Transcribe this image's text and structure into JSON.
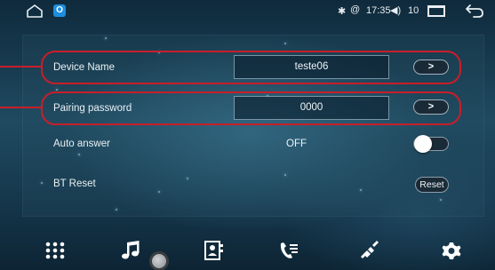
{
  "status_bar": {
    "app_badge": "O",
    "bluetooth_icon": "bluetooth-icon",
    "wifi_icon": "wifi-icon",
    "time": "17:35",
    "volume_icon": "volume-icon",
    "volume": "10"
  },
  "settings": {
    "device_name": {
      "label": "Device Name",
      "value": "teste06",
      "action": ">"
    },
    "pairing_password": {
      "label": "Pairing password",
      "value": "0000",
      "action": ">"
    },
    "auto_answer": {
      "label": "Auto answer",
      "value": "OFF",
      "toggle_on": false
    },
    "bt_reset": {
      "label": "BT Reset",
      "button": "Reset"
    }
  },
  "dock": {
    "items": [
      "apps-grid-icon",
      "music-icon",
      "contacts-icon",
      "call-log-icon",
      "bluetooth-connect-icon",
      "settings-gear-icon"
    ]
  },
  "colors": {
    "highlight": "#c81e2a",
    "background": "#1f4a60",
    "text": "#e9f1f5"
  }
}
